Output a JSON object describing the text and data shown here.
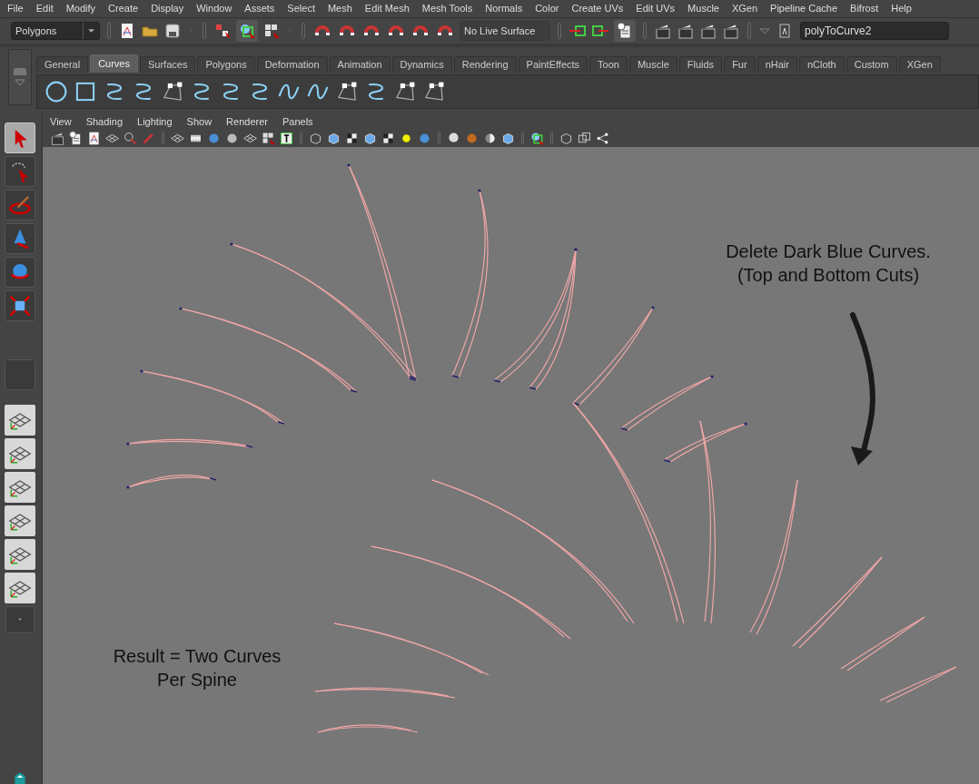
{
  "menu_bar": [
    "File",
    "Edit",
    "Modify",
    "Create",
    "Display",
    "Window",
    "Assets",
    "Select",
    "Mesh",
    "Edit Mesh",
    "Mesh Tools",
    "Normals",
    "Color",
    "Create UVs",
    "Edit UVs",
    "Muscle",
    "XGen",
    "Pipeline Cache",
    "Bifrost",
    "Help"
  ],
  "status_line": {
    "menu_set": {
      "value": "Polygons"
    },
    "live_surface": "No Live Surface",
    "name_field": {
      "value": "polyToCurve2"
    }
  },
  "shelf_tabs": [
    {
      "label": "General",
      "selected": false
    },
    {
      "label": "Curves",
      "selected": true
    },
    {
      "label": "Surfaces",
      "selected": false
    },
    {
      "label": "Polygons",
      "selected": false
    },
    {
      "label": "Deformation",
      "selected": false
    },
    {
      "label": "Animation",
      "selected": false
    },
    {
      "label": "Dynamics",
      "selected": false
    },
    {
      "label": "Rendering",
      "selected": false
    },
    {
      "label": "PaintEffects",
      "selected": false
    },
    {
      "label": "Toon",
      "selected": false
    },
    {
      "label": "Muscle",
      "selected": false
    },
    {
      "label": "Fluids",
      "selected": false
    },
    {
      "label": "Fur",
      "selected": false
    },
    {
      "label": "nHair",
      "selected": false
    },
    {
      "label": "nCloth",
      "selected": false
    },
    {
      "label": "Custom",
      "selected": false
    },
    {
      "label": "XGen",
      "selected": false
    }
  ],
  "toolbox": [
    {
      "selected": true
    },
    {
      "selected": false
    },
    {
      "selected": false
    },
    {
      "selected": false
    },
    {
      "selected": false
    },
    {
      "selected": false
    }
  ],
  "panel_menu": [
    "View",
    "Shading",
    "Lighting",
    "Show",
    "Renderer",
    "Panels"
  ],
  "viewport": {
    "annotations": [
      {
        "lines": [
          "Delete Dark Blue Curves.",
          "(Top and Bottom Cuts)"
        ]
      },
      {
        "lines": [
          "Result = Two Curves",
          "Per Spine"
        ]
      }
    ]
  }
}
